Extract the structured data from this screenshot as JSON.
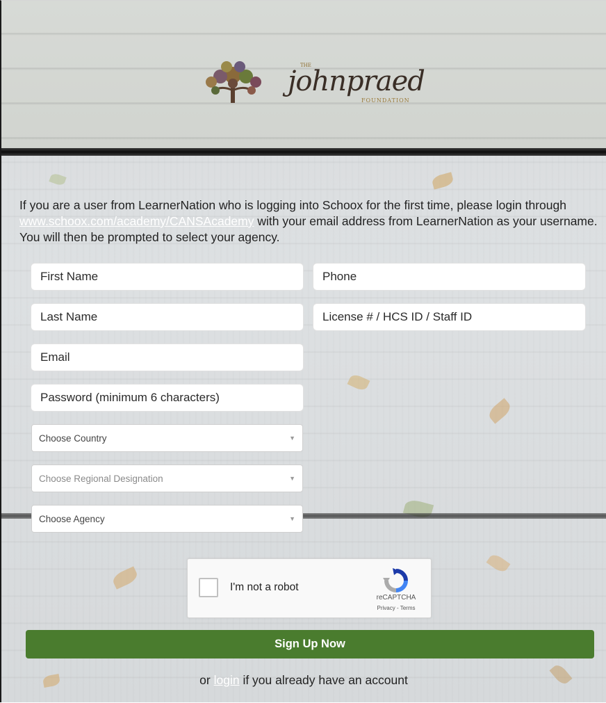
{
  "logo": {
    "the": "THE",
    "wordmark": "johnpraed",
    "foundation": "FOUNDATION"
  },
  "intro": {
    "part1": "If you are a user from LearnerNation who is logging into Schoox for the first time, please login through ",
    "link": "www.schoox.com/academy/CANSAcademy",
    "part2": " with your email address from LearnerNation as your username. You will then be prompted to select your agency."
  },
  "form": {
    "first_name_placeholder": "First Name",
    "phone_placeholder": "Phone",
    "last_name_placeholder": "Last Name",
    "license_placeholder": "License # / HCS ID / Staff ID",
    "email_placeholder": "Email",
    "password_placeholder": "Password (minimum 6 characters)",
    "country": "Choose Country",
    "region": "Choose Regional Designation",
    "agency": "Choose Agency"
  },
  "captcha": {
    "label": "I'm not a robot",
    "brand": "reCAPTCHA",
    "terms": "Privacy - Terms"
  },
  "signup_label": "Sign Up Now",
  "footer": {
    "prefix": "or ",
    "login": "login",
    "suffix": " if you already have an account"
  },
  "colors": {
    "signup": "#4a7c2e",
    "link": "#ffffff"
  },
  "icons": {
    "caret": "▼"
  }
}
